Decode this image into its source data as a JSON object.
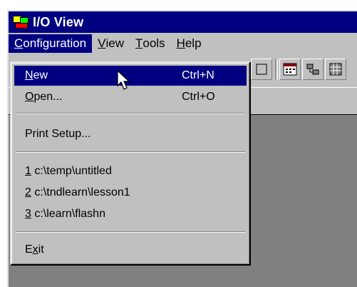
{
  "window": {
    "title": "I/O View"
  },
  "menubar": {
    "items": [
      {
        "label": "Configuration",
        "mnemonic": "C",
        "rest": "onfiguration",
        "active": true
      },
      {
        "label": "View",
        "mnemonic": "V",
        "rest": "iew"
      },
      {
        "label": "Tools",
        "mnemonic": "T",
        "rest": "ools"
      },
      {
        "label": "Help",
        "mnemonic": "H",
        "rest": "elp"
      }
    ]
  },
  "dropdown": {
    "items": [
      {
        "pre": "",
        "mn": "N",
        "post": "ew",
        "accel": "Ctrl+N",
        "highlighted": true
      },
      {
        "pre": "",
        "mn": "O",
        "post": "pen...",
        "accel": "Ctrl+O"
      },
      {
        "pre": "Print Setup...",
        "mn": "",
        "post": ""
      },
      {
        "pre": "",
        "mn": "1",
        "post": " c:\\temp\\untitled"
      },
      {
        "pre": "",
        "mn": "2",
        "post": " c:\\tndlearn\\lesson1"
      },
      {
        "pre": "",
        "mn": "3",
        "post": " c:\\learn\\flashn"
      },
      {
        "pre": "E",
        "mn": "x",
        "post": "it"
      }
    ]
  },
  "icons": {
    "app": "io-view-app-icon",
    "toolbar": [
      "toolbar-button-icon",
      "calendar-icon",
      "network-icon",
      "grid-icon"
    ],
    "cursor": "mouse-pointer-icon"
  },
  "colors": {
    "titlebar": "#000080",
    "highlight": "#000080",
    "face": "#c0c0c0",
    "workspace": "#808080"
  }
}
